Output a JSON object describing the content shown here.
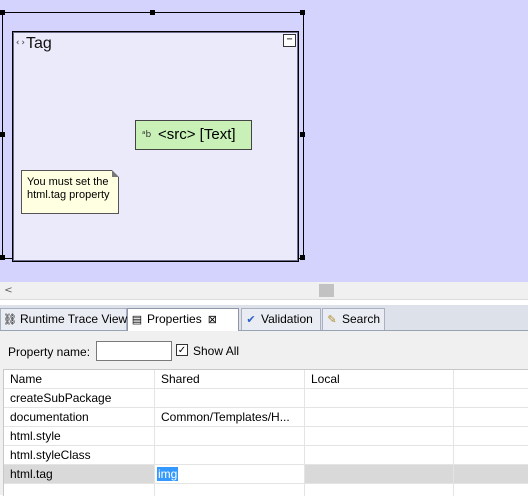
{
  "diagram": {
    "tag_title": "Tag",
    "collapse_symbol": "−",
    "src_label": "<src> [Text]",
    "note_text_line1": "You must set the",
    "note_text_line2": "html.tag property"
  },
  "tabs": [
    {
      "label": "Runtime Trace View",
      "icon": "runtime-trace-icon"
    },
    {
      "label": "Properties",
      "icon": "properties-icon",
      "active": true
    },
    {
      "label": "Validation",
      "icon": "validation-icon"
    },
    {
      "label": "Search",
      "icon": "search-icon"
    }
  ],
  "properties": {
    "name_label": "Property name:",
    "name_value": "",
    "show_all_label": "Show All",
    "show_all_checked": true,
    "columns": [
      "Name",
      "Shared",
      "Local",
      ""
    ],
    "rows": [
      {
        "name": "createSubPackage",
        "shared": "",
        "local": ""
      },
      {
        "name": "documentation",
        "shared": "Common/Templates/H...",
        "local": ""
      },
      {
        "name": "html.style",
        "shared": "",
        "local": ""
      },
      {
        "name": "html.styleClass",
        "shared": "",
        "local": ""
      },
      {
        "name": "html.tag",
        "shared": "img",
        "local": ""
      }
    ]
  },
  "colors": {
    "canvas": "#d3d3fd",
    "tag_fill": "#eaeafb",
    "src_fill": "#c8f0b7",
    "note_fill": "#ffffe1",
    "selection_highlight": "#3399ff"
  }
}
